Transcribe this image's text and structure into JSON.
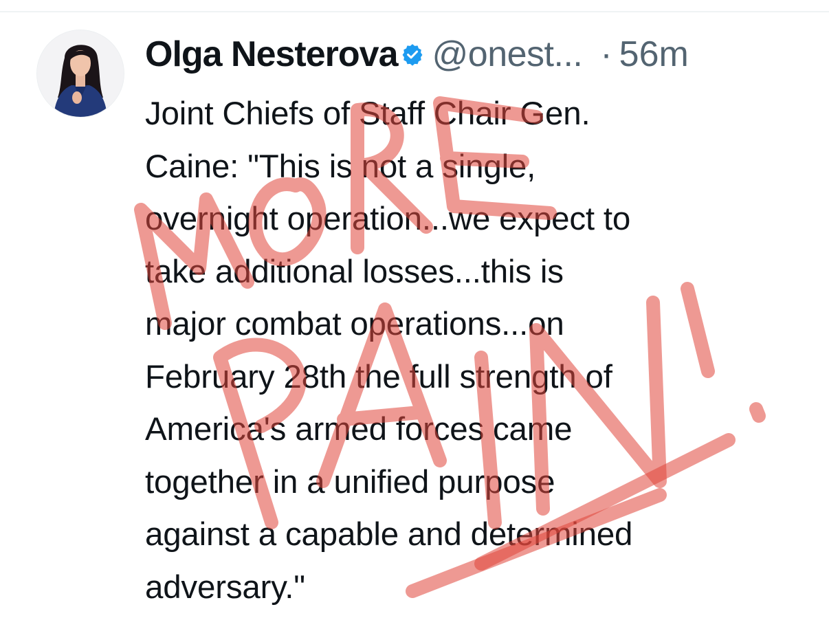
{
  "post": {
    "author": {
      "display_name": "Olga Nesterova",
      "handle": "@onest...",
      "verified": true,
      "verified_icon": "verified-badge-icon"
    },
    "separator": "·",
    "timestamp": "56m",
    "text": "Joint Chiefs of Staff Chair Gen.\nCaine: \"This is not a single,\novernight operation...we expect to\ntake additional losses...this is\nmajor combat operations...on\nFebruary 28th the full strength of\nAmerica's armed forces came\ntogether in a unified purpose\nagainst a capable and determined\nadversary.\""
  },
  "overlay": {
    "handwriting": "MORE PAIN",
    "color": "#e0463a"
  },
  "colors": {
    "text": "#0f1419",
    "secondary": "#536471",
    "verified": "#1d9bf0"
  }
}
